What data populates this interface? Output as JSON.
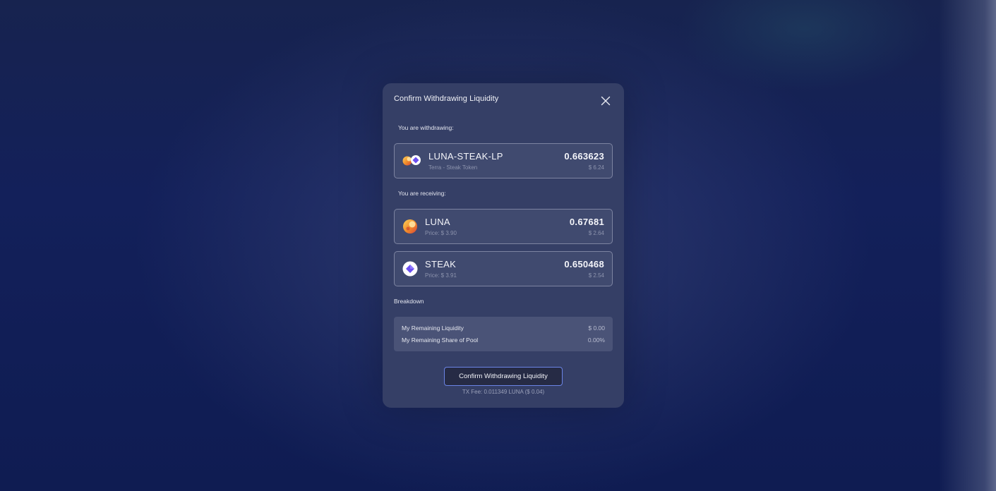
{
  "modal": {
    "title": "Confirm Withdrawing Liquidity",
    "close_icon": "close-icon"
  },
  "withdrawing": {
    "label": "You are withdrawing:",
    "token": {
      "name": "LUNA-STEAK-LP",
      "subtitle": "Terra - Steak Token",
      "amount": "0.663623",
      "value": "$ 6.24",
      "icon": "luna-steak-pair-icon"
    }
  },
  "receiving": {
    "label": "You are receiving:",
    "tokens": [
      {
        "name": "LUNA",
        "price": "Price: $ 3.90",
        "amount": "0.67681",
        "value": "$ 2.64",
        "icon": "luna-icon"
      },
      {
        "name": "STEAK",
        "price": "Price: $ 3.91",
        "amount": "0.650468",
        "value": "$ 2.54",
        "icon": "steak-icon"
      }
    ]
  },
  "breakdown": {
    "label": "Breakdown",
    "rows": [
      {
        "label": "My Remaining Liquidity",
        "value": "$ 0.00"
      },
      {
        "label": "My Remaining Share of Pool",
        "value": "0.00%"
      }
    ]
  },
  "confirm": {
    "button_label": "Confirm Withdrawing Liquidity",
    "tx_fee": "TX Fee: 0.011349 LUNA ($ 0.04)"
  },
  "colors": {
    "background": "#0f1a4a",
    "modal": "#353f66",
    "button_border": "#6b84e6",
    "luna_orange": "#f5a623",
    "steak_purple": "#6b4ef0"
  }
}
